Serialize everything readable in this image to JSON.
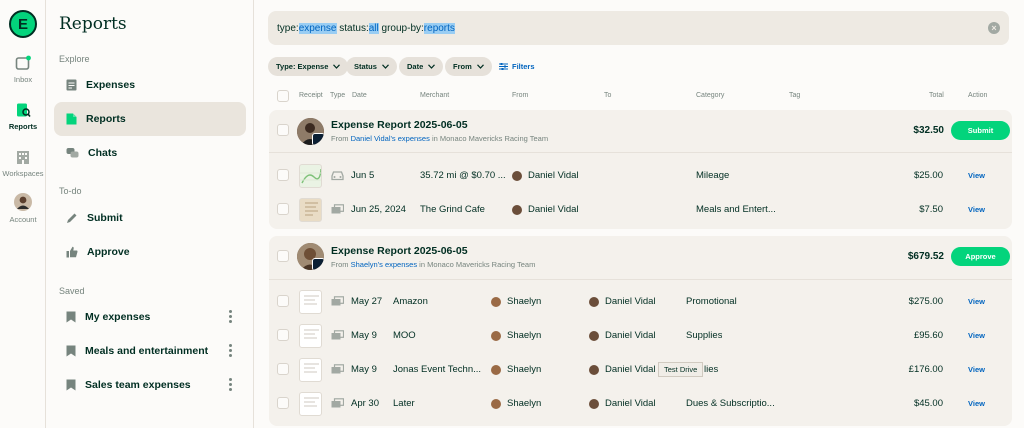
{
  "rail": {
    "logo": "E",
    "items": [
      {
        "label": "Inbox",
        "icon": "inbox-icon"
      },
      {
        "label": "Reports",
        "icon": "reports-icon"
      },
      {
        "label": "Workspaces",
        "icon": "building-icon"
      },
      {
        "label": "Account",
        "icon": "avatar"
      }
    ]
  },
  "sidebar": {
    "title": "Reports",
    "explore_label": "Explore",
    "explore": [
      {
        "label": "Expenses",
        "icon": "receipt-icon"
      },
      {
        "label": "Reports",
        "icon": "document-icon"
      },
      {
        "label": "Chats",
        "icon": "chat-bubbles-icon"
      }
    ],
    "todo_label": "To-do",
    "todo": [
      {
        "label": "Submit",
        "icon": "pencil-icon"
      },
      {
        "label": "Approve",
        "icon": "thumbs-up-icon"
      }
    ],
    "saved_label": "Saved",
    "saved": [
      {
        "label": "My expenses",
        "icon": "bookmark-icon"
      },
      {
        "label": "Meals and entertainment",
        "icon": "bookmark-icon"
      },
      {
        "label": "Sales team expenses",
        "icon": "bookmark-icon"
      }
    ]
  },
  "search": {
    "k1": "type:",
    "v1": "expense",
    "k2": " status:",
    "v2": "all",
    "k3": " group-by:",
    "v3": "reports"
  },
  "filters": {
    "chips": [
      "Type: Expense",
      "Status",
      "Date",
      "From"
    ],
    "filters_label": "Filters"
  },
  "table": {
    "headers": [
      "Receipt",
      "Type",
      "Date",
      "Merchant",
      "From",
      "To",
      "Category",
      "Tag",
      "Total",
      "Action"
    ]
  },
  "groups": [
    {
      "title": "Expense Report 2025-06-05",
      "from_prefix": "From ",
      "from_link": "Daniel Vidal's expenses",
      "from_suffix": " in Monaco Mavericks Racing Team",
      "total": "$32.50",
      "action": "Submit",
      "rows": [
        {
          "date": "Jun 5",
          "merchant": "35.72 mi @ $0.70 ...",
          "from": "Daniel Vidal",
          "to": "",
          "category": "Mileage",
          "total": "$25.00",
          "action": "View",
          "type_icon": "car-icon"
        },
        {
          "date": "Jun 25, 2024",
          "merchant": "The Grind Cafe",
          "from": "Daniel Vidal",
          "to": "",
          "category": "Meals and Entert...",
          "total": "$7.50",
          "action": "View",
          "type_icon": "cash-icon"
        }
      ]
    },
    {
      "title": "Expense Report 2025-06-05",
      "from_prefix": "From ",
      "from_link": "Shaelyn's expenses",
      "from_suffix": " in Monaco Mavericks Racing Team",
      "total": "$679.52",
      "action": "Approve",
      "rows": [
        {
          "date": "May 27",
          "merchant": "Amazon",
          "from": "Shaelyn",
          "to": "Daniel Vidal",
          "category": "Promotional",
          "total": "$275.00",
          "action": "View",
          "type_icon": "cash-icon"
        },
        {
          "date": "May 9",
          "merchant": "MOO",
          "from": "Shaelyn",
          "to": "Daniel Vidal",
          "category": "Supplies",
          "total": "£95.60",
          "action": "View",
          "type_icon": "cash-icon"
        },
        {
          "date": "May 9",
          "merchant": "Jonas Event Techn...",
          "from": "Shaelyn",
          "to": "Daniel Vidal",
          "category": "lies",
          "total": "£176.00",
          "action": "View",
          "type_icon": "cash-icon"
        },
        {
          "date": "Apr 30",
          "merchant": "Later",
          "from": "Shaelyn",
          "to": "Daniel Vidal",
          "category": "Dues & Subscriptio...",
          "total": "$45.00",
          "action": "View",
          "type_icon": "cash-icon"
        }
      ]
    }
  ],
  "tooltip": "Test Drive",
  "colors": {
    "accent": "#03D47C",
    "link": "#0164BF",
    "text": "#002E22",
    "muted": "#76847E"
  }
}
